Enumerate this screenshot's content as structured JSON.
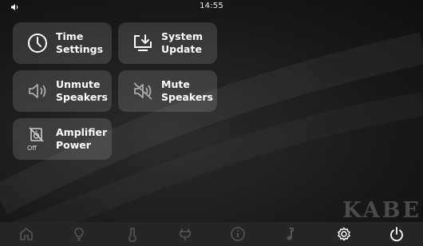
{
  "status_bar": {
    "time": "14:55",
    "speaker_icon": "speaker-small-icon"
  },
  "tiles": [
    {
      "line1": "Time",
      "line2": "Settings",
      "icon": "clock-icon"
    },
    {
      "line1": "System",
      "line2": "Update",
      "icon": "download-icon"
    },
    {
      "line1": "Unmute",
      "line2": "Speakers",
      "icon": "speaker-icon"
    },
    {
      "line1": "Mute",
      "line2": "Speakers",
      "icon": "speaker-muted-icon"
    },
    {
      "line1": "Amplifier",
      "line2": "Power",
      "icon": "amplifier-icon",
      "state": "Off"
    }
  ],
  "brand": "KABE",
  "nav": [
    {
      "icon": "home-icon"
    },
    {
      "icon": "light-bulb-icon"
    },
    {
      "icon": "thermometer-icon"
    },
    {
      "icon": "power-plug-icon"
    },
    {
      "icon": "info-icon"
    },
    {
      "icon": "music-note-icon"
    },
    {
      "icon": "settings-gear-icon",
      "active": true
    },
    {
      "icon": "power-icon",
      "active": true
    }
  ],
  "colors": {
    "active_icon": "#ffffff",
    "inactive_icon": "#555555",
    "tile_bg": "rgba(255,255,255,0.13)"
  }
}
